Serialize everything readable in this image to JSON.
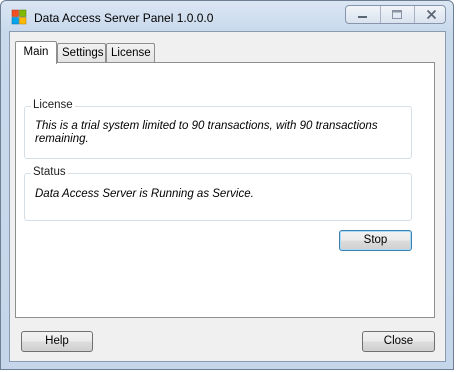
{
  "window": {
    "title": "Data Access Server Panel 1.0.0.0",
    "icon": "app-window-icon",
    "caption_buttons": [
      "minimize-icon",
      "maximize-icon",
      "close-icon"
    ]
  },
  "tabs": [
    {
      "label": "Main",
      "active": true
    },
    {
      "label": "Settings",
      "active": false
    },
    {
      "label": "License",
      "active": false
    }
  ],
  "main": {
    "license_group": {
      "label": "License",
      "text": "This is a trial system limited to 90 transactions, with 90 transactions remaining."
    },
    "status_group": {
      "label": "Status",
      "text": "Data Access Server is Running as Service."
    },
    "stop_label": "Stop"
  },
  "footer": {
    "help_label": "Help",
    "close_label": "Close"
  },
  "colors": {
    "title_bar": "#c9d9ec",
    "client_bg": "#f0f0f0",
    "group_border": "#d5dfe5",
    "button_focus": "#3c7fb1"
  }
}
